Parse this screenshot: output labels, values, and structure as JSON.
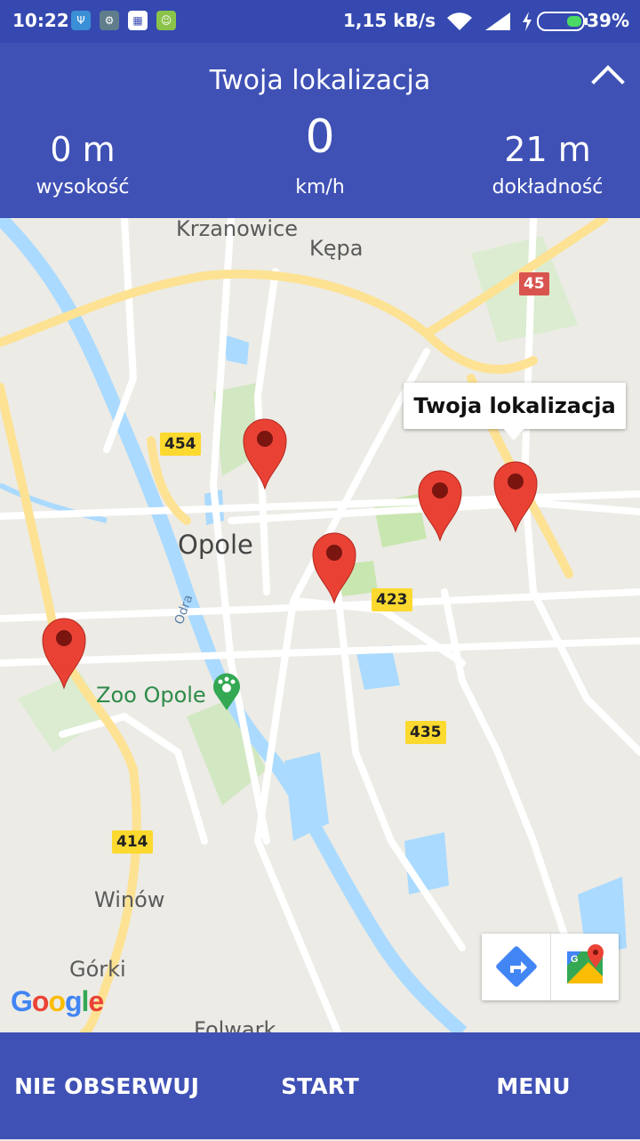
{
  "status_bar": {
    "time": "10:22",
    "speed": "1,15 kB/s",
    "battery": "39%",
    "icons": [
      "usb-icon",
      "settings-app-icon",
      "calendar-app-icon",
      "android-icon",
      "wifi-icon",
      "signal-icon",
      "charging-icon",
      "battery-icon"
    ]
  },
  "header": {
    "title": "Twoja lokalizacja",
    "altitude": {
      "value": "0 m",
      "label": "wysokość"
    },
    "speed": {
      "value": "0",
      "label": "km/h"
    },
    "accuracy": {
      "value": "21 m",
      "label": "dokładność"
    },
    "colors": {
      "background": "#3f51b5",
      "status_bar": "#3549b0"
    }
  },
  "map": {
    "places": {
      "krzanowice": "Krzanowice",
      "kepa": "Kępa",
      "opole": "Opole",
      "zoo": "Zoo Opole",
      "odra": "Odra",
      "winow": "Winów",
      "gorki": "Górki",
      "folwark": "Folwark"
    },
    "road_numbers": {
      "r45": "45",
      "r454": "454",
      "r423": "423",
      "r435": "435",
      "r414": "414"
    },
    "tooltip": "Twoja lokalizacja",
    "google_logo": [
      "G",
      "o",
      "o",
      "g",
      "l",
      "e"
    ],
    "colors": {
      "pin": "#e94235",
      "road_major": "#fdd96a",
      "water": "#aadaff",
      "park": "#c8e6b0"
    }
  },
  "bottom_bar": {
    "unwatch_label": "NIE OBSERWUJ",
    "start_label": "START",
    "menu_label": "MENU"
  }
}
